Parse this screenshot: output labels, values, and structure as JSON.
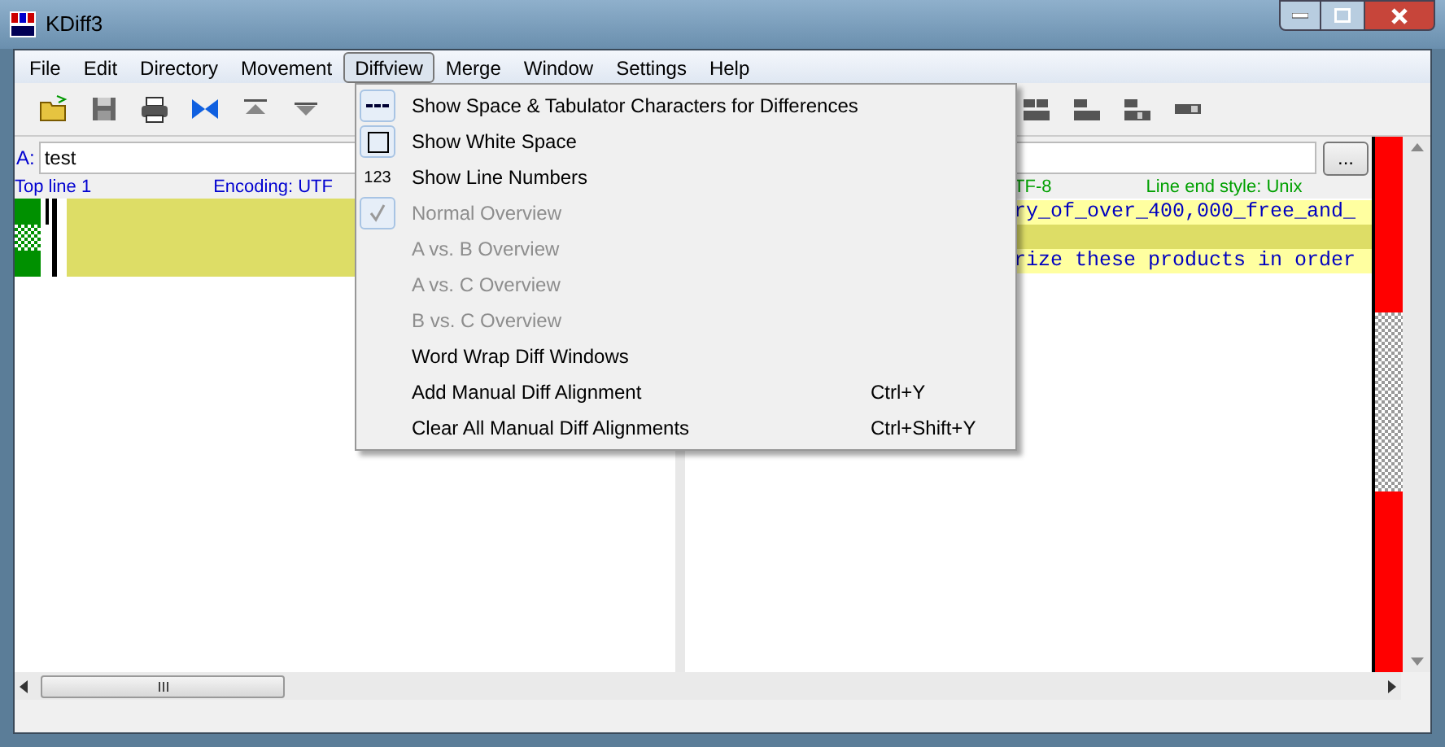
{
  "window": {
    "title": "KDiff3"
  },
  "menu_bar": [
    {
      "label": "File",
      "selected": false
    },
    {
      "label": "Edit",
      "selected": false
    },
    {
      "label": "Directory",
      "selected": false
    },
    {
      "label": "Movement",
      "selected": false
    },
    {
      "label": "Diffview",
      "selected": true
    },
    {
      "label": "Merge",
      "selected": false
    },
    {
      "label": "Window",
      "selected": false
    },
    {
      "label": "Settings",
      "selected": false
    },
    {
      "label": "Help",
      "selected": false
    }
  ],
  "diffview_menu": [
    {
      "kind": "dashes",
      "label": "Show Space & Tabulator Characters for Differences",
      "checked": true,
      "disabled": false
    },
    {
      "kind": "box",
      "label": "Show White Space",
      "checked": true,
      "disabled": false
    },
    {
      "kind": "text",
      "icon_text": "123",
      "label": "Show Line Numbers",
      "checked": false,
      "disabled": false
    },
    {
      "kind": "check",
      "label": "Normal Overview",
      "checked": true,
      "disabled": true
    },
    {
      "kind": "plain",
      "label": "A vs. B Overview",
      "disabled": true
    },
    {
      "kind": "plain",
      "label": "A vs. C Overview",
      "disabled": true
    },
    {
      "kind": "plain",
      "label": "B vs. C Overview",
      "disabled": true
    },
    {
      "kind": "plain",
      "label": "Word Wrap Diff Windows",
      "disabled": false
    },
    {
      "kind": "plain",
      "label": "Add Manual Diff Alignment",
      "shortcut": "Ctrl+Y",
      "disabled": false
    },
    {
      "kind": "plain",
      "label": "Clear All Manual Diff Alignments",
      "shortcut": "Ctrl+Shift+Y",
      "disabled": false
    }
  ],
  "left_pane": {
    "label": "A:",
    "value": "test",
    "top_line": "Top line 1",
    "encoding": "Encoding: UTF"
  },
  "right_pane": {
    "encoding": "TF-8",
    "line_end": "Line end style: Unix",
    "browse": "...",
    "lines": [
      {
        "kind": "text",
        "text": "ry_of_over_400,000_free_and_"
      },
      {
        "kind": "changed"
      },
      {
        "kind": "text",
        "text": "rize these products in order"
      }
    ]
  }
}
